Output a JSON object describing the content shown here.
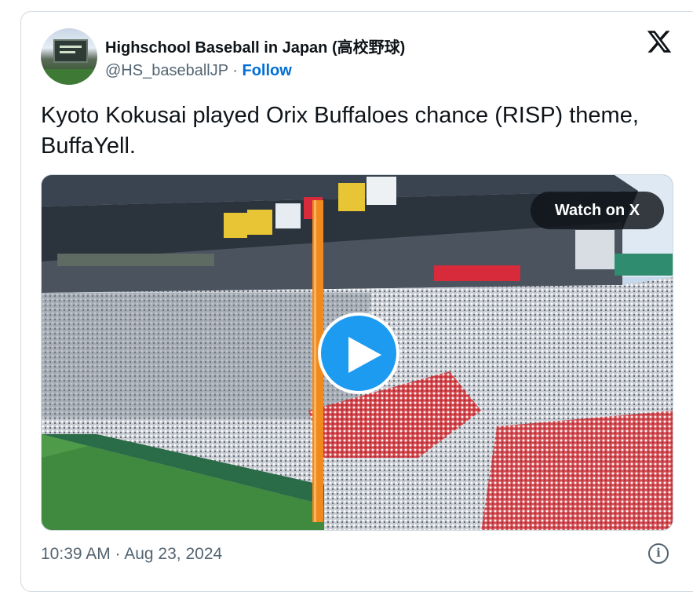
{
  "author": {
    "display_name": "Highschool Baseball in Japan (高校野球)",
    "handle": "@HS_baseballJP",
    "separator": "·",
    "follow_label": "Follow"
  },
  "tweet": {
    "text": "Kyoto Kokusai played Orix Buffaloes chance (RISP) theme, BuffaYell."
  },
  "media": {
    "watch_label": "Watch on X",
    "play_icon": "play-icon"
  },
  "footer": {
    "timestamp": "10:39 AM · Aug 23, 2024",
    "info_icon": "info-icon"
  },
  "colors": {
    "follow": "#006fd6",
    "play_button": "#1d9bf0",
    "muted_text": "#536471",
    "border": "#cfd9de"
  }
}
